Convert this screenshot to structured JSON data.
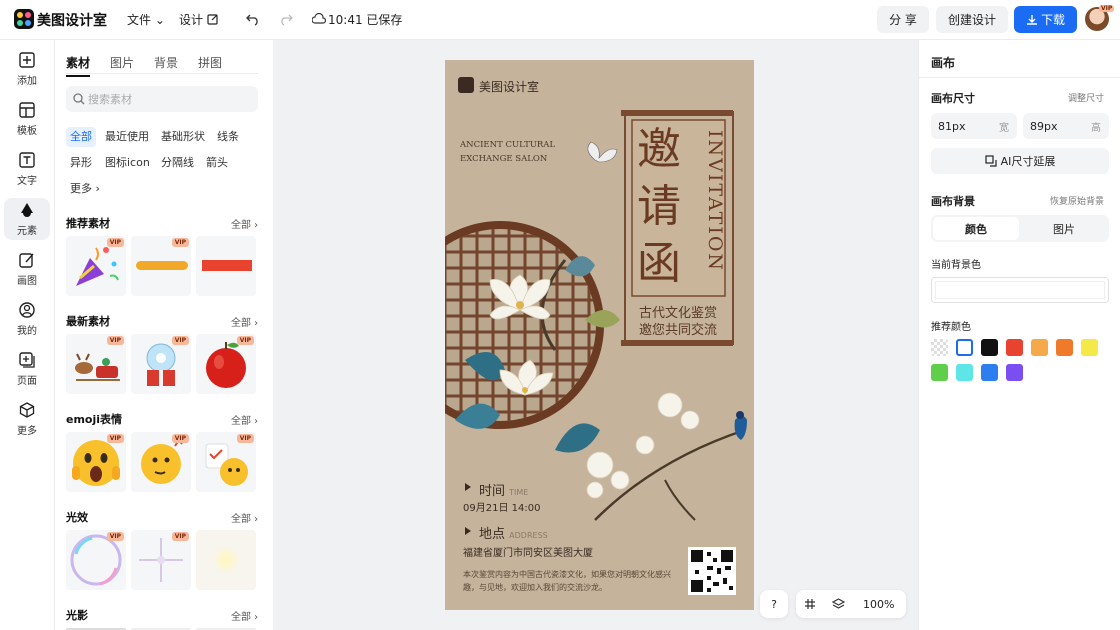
{
  "app": {
    "brand": "美图设计室",
    "menu_file": "文件",
    "menu_design": "设计",
    "save_status": "10:41 已保存",
    "share": "分 享",
    "create": "创建设计",
    "download": "下载"
  },
  "nav": [
    {
      "label": "添加"
    },
    {
      "label": "模板"
    },
    {
      "label": "文字"
    },
    {
      "label": "元素"
    },
    {
      "label": "画图"
    },
    {
      "label": "我的"
    },
    {
      "label": "页面"
    },
    {
      "label": "更多"
    }
  ],
  "panel": {
    "tabs": [
      "素材",
      "图片",
      "背景",
      "拼图"
    ],
    "search_placeholder": "搜索素材",
    "chips": [
      "全部",
      "最近使用",
      "基础形状",
      "线条",
      "异形",
      "图标icon",
      "分隔线",
      "箭头",
      "更多"
    ],
    "sections": [
      {
        "title": "推荐素材",
        "all": "全部"
      },
      {
        "title": "最新素材",
        "all": "全部"
      },
      {
        "title": "emoji表情",
        "all": "全部"
      },
      {
        "title": "光效",
        "all": "全部"
      },
      {
        "title": "光影",
        "all": "全部"
      }
    ],
    "vip": "VIP"
  },
  "poster": {
    "logo_text": "美图设计室",
    "en_line1": "ANCIENT CULTURAL",
    "en_line2": "EXCHANGE SALON",
    "title_zh": [
      "邀",
      "请",
      "函"
    ],
    "title_en": "INVITATION",
    "sub1": "古代文化鉴赏",
    "sub2": "邀您共同交流",
    "time_label": "时间",
    "time_en": "TIME",
    "time_value": "09月21日 14:00",
    "place_label": "地点",
    "place_en": "ADDRESS",
    "place_value": "福建省厦门市同安区美图大厦",
    "desc": "本次鉴赏内容为中国古代瓷漆文化，如果您对明朝文化感兴趣，与见地，欢迎加入我们的交流沙龙。"
  },
  "right": {
    "title": "画布",
    "size_label": "画布尺寸",
    "size_adjust": "调整尺寸",
    "width_value": "81px",
    "width_unit": "宽",
    "height_value": "89px",
    "height_unit": "高",
    "ai_extend": "AI尺寸延展",
    "bg_label": "画布背景",
    "bg_restore": "恢复原始背景",
    "bg_tab_color": "颜色",
    "bg_tab_image": "图片",
    "current_bg": "当前背景色",
    "recommend": "推荐颜色",
    "swatches": [
      "transparent",
      "#ffffff",
      "#111111",
      "#e8432e",
      "#f6a94b",
      "#ef7b2a",
      "#f5e94a",
      "#5fcf4a",
      "#5ee6e6",
      "#2d7ff0",
      "#7a4ef0"
    ]
  },
  "zoom": {
    "help": "?",
    "level": "100%"
  }
}
